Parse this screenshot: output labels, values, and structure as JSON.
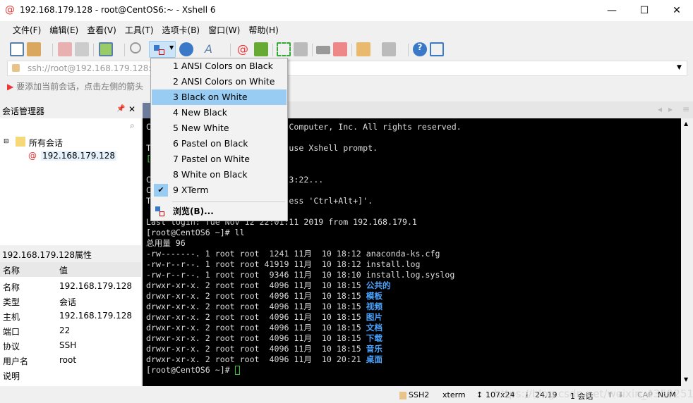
{
  "window": {
    "title": "192.168.179.128 - root@CentOS6:~ - Xshell 6",
    "minimize": "—",
    "maximize": "☐",
    "close": "✕"
  },
  "menubar": [
    "文件(F)",
    "编辑(E)",
    "查看(V)",
    "工具(T)",
    "选项卡(B)",
    "窗口(W)",
    "帮助(H)"
  ],
  "address": {
    "value": "ssh://root@192.168.179.128:2"
  },
  "hint": "要添加当前会话，点击左侧的箭头",
  "session_manager": {
    "title": "会话管理器",
    "pin": "📌",
    "close": "✕",
    "tree": {
      "root": "所有会话",
      "child": "192.168.179.128"
    }
  },
  "properties": {
    "title": "192.168.179.128属性",
    "header": [
      "名称",
      "值"
    ],
    "rows": [
      [
        "名称",
        "192.168.179.128"
      ],
      [
        "类型",
        "会话"
      ],
      [
        "主机",
        "192.168.179.128"
      ],
      [
        "端口",
        "22"
      ],
      [
        "协议",
        "SSH"
      ],
      [
        "用户名",
        "root"
      ],
      [
        "说明",
        ""
      ]
    ]
  },
  "color_scheme_menu": {
    "items": [
      "1 ANSI Colors on Black",
      "2 ANSI Colors on White",
      "3 Black on White",
      "4 New Black",
      "5 New White",
      "6 Pastel on Black",
      "7 Pastel on White",
      "8 White on Black",
      "9 XTerm"
    ],
    "highlighted": "3 Black on White",
    "checked": "9 XTerm",
    "browse": "浏览(B)..."
  },
  "terminal": {
    "lines": [
      "C                            Computer, Inc. All rights reserved.",
      "",
      "T                            use Xshell prompt.",
      "[",
      "",
      "C                            3:22...",
      "C",
      "T                            ess 'Ctrl+Alt+]'.",
      "",
      "Last login: Tue Nov 12 22:01:11 2019 from 192.168.179.1",
      "[root@CentOS6 ~]# ll",
      "总用量 96",
      "-rw-------. 1 root root  1241 11月  10 18:12 anaconda-ks.cfg",
      "-rw-r--r--. 1 root root 41919 11月  10 18:12 install.log",
      "-rw-r--r--. 1 root root  9346 11月  10 18:10 install.log.syslog"
    ],
    "dirs": [
      [
        "drwxr-xr-x. 2 root root  4096 11月  10 18:15 ",
        "公共的"
      ],
      [
        "drwxr-xr-x. 2 root root  4096 11月  10 18:15 ",
        "模板"
      ],
      [
        "drwxr-xr-x. 2 root root  4096 11月  10 18:15 ",
        "视频"
      ],
      [
        "drwxr-xr-x. 2 root root  4096 11月  10 18:15 ",
        "图片"
      ],
      [
        "drwxr-xr-x. 2 root root  4096 11月  10 18:15 ",
        "文档"
      ],
      [
        "drwxr-xr-x. 2 root root  4096 11月  10 18:15 ",
        "下载"
      ],
      [
        "drwxr-xr-x. 2 root root  4096 11月  10 18:15 ",
        "音乐"
      ],
      [
        "drwxr-xr-x. 2 root root  4096 11月  10 20:21 ",
        "桌面"
      ]
    ],
    "prompt": "[root@CentOS6 ~]# "
  },
  "status": {
    "protocol": "SSH2",
    "term": "xterm",
    "size": "107x24",
    "cursor": "24,19",
    "sessions": "1 会话",
    "cap": "CAP",
    "num": "NUM",
    "watermark": "https://blog.csdn.net/weixin_43592512"
  },
  "colors": {
    "dir": "#4aa3ff",
    "highlight": "#99ccf3",
    "arrow": "#ee3333"
  }
}
